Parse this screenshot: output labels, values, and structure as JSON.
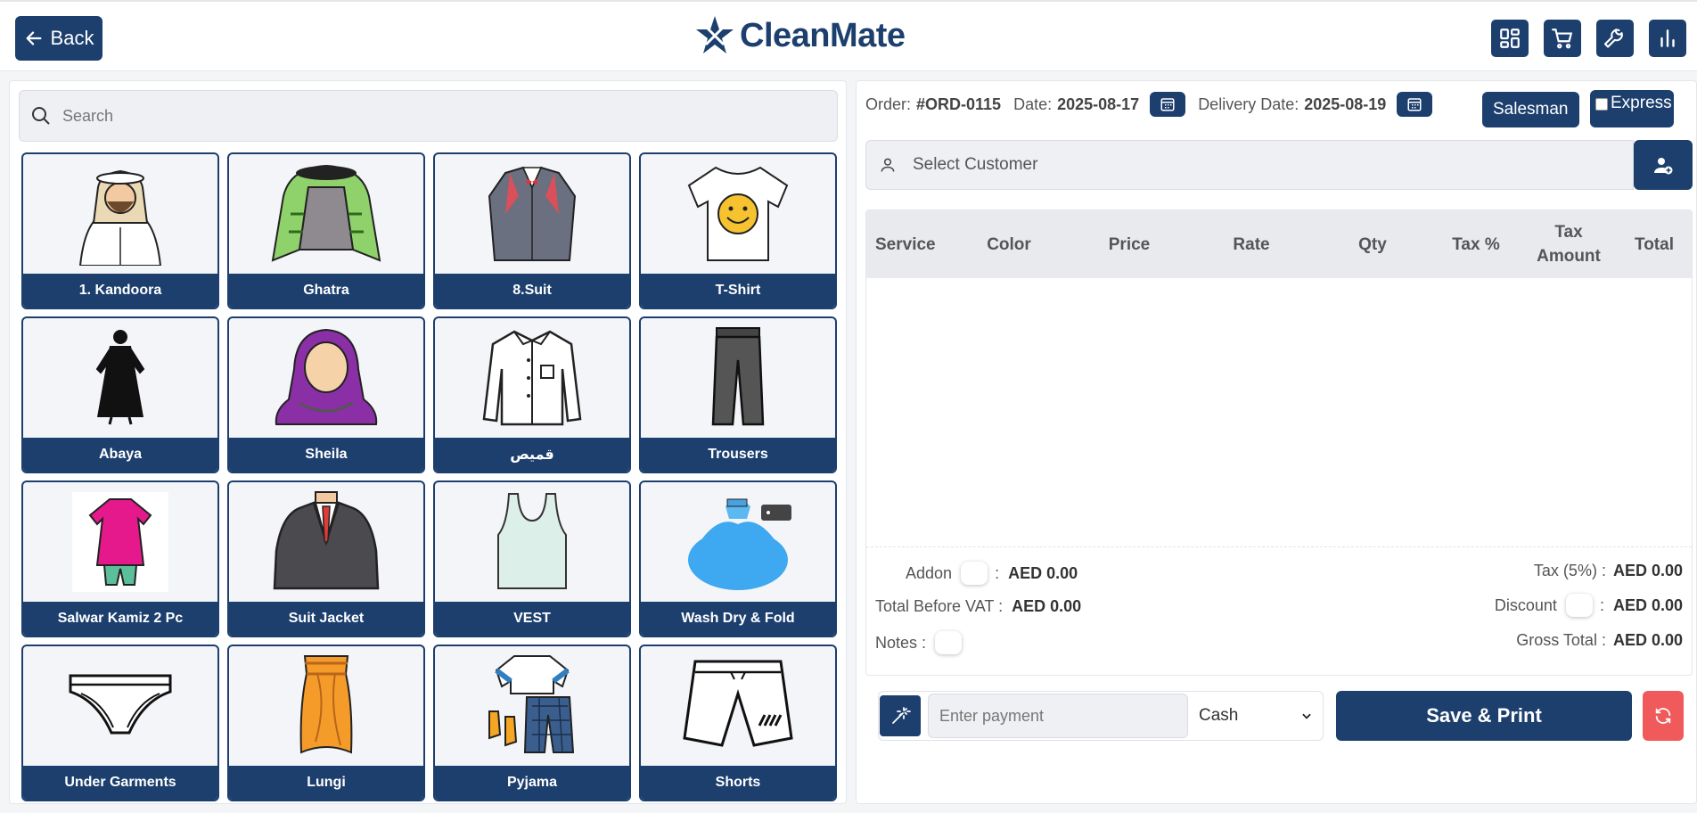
{
  "header": {
    "back_label": "Back",
    "brand": "CleanMate",
    "icons": [
      "grid-icon",
      "cart-icon",
      "wrench-icon",
      "bar-chart-icon"
    ],
    "accent_color": "#1c3f6e"
  },
  "search": {
    "placeholder": "Search"
  },
  "items": [
    {
      "label": "1. Kandoora",
      "icon": "kandoora-icon"
    },
    {
      "label": "Ghatra",
      "icon": "ghatra-icon"
    },
    {
      "label": "8.Suit",
      "icon": "suit-icon"
    },
    {
      "label": "T-Shirt",
      "icon": "tshirt-icon"
    },
    {
      "label": "Abaya",
      "icon": "abaya-icon"
    },
    {
      "label": "Sheila",
      "icon": "sheila-icon"
    },
    {
      "label": "قميص",
      "icon": "shirt-icon"
    },
    {
      "label": "Trousers",
      "icon": "trousers-icon"
    },
    {
      "label": "Salwar Kamiz 2 Pc",
      "icon": "salwar-kamiz-icon"
    },
    {
      "label": "Suit Jacket",
      "icon": "suit-jacket-icon"
    },
    {
      "label": "VEST",
      "icon": "vest-icon"
    },
    {
      "label": "Wash Dry & Fold",
      "icon": "laundry-bag-icon"
    },
    {
      "label": "Under Garments",
      "icon": "underwear-icon"
    },
    {
      "label": "Lungi",
      "icon": "lungi-icon"
    },
    {
      "label": "Pyjama",
      "icon": "pyjama-icon"
    },
    {
      "label": "Shorts",
      "icon": "shorts-icon"
    }
  ],
  "order": {
    "order_label": "Order:",
    "order_no": "#ORD-0115",
    "date_label": "Date:",
    "date": "2025-08-17",
    "delivery_label": "Delivery Date:",
    "delivery_date": "2025-08-19",
    "salesman_label": "Salesman",
    "express_label": "Express"
  },
  "customer": {
    "placeholder": "Select  Customer"
  },
  "table": {
    "columns": [
      "Service",
      "Color",
      "Price",
      "Rate",
      "Qty",
      "Tax %",
      "Tax Amount",
      "Total"
    ],
    "rows": []
  },
  "totals": {
    "addon_label": "Addon",
    "addon_value": "AED 0.00",
    "before_vat_label": "Total Before VAT :",
    "before_vat_value": "AED 0.00",
    "notes_label": "Notes :",
    "tax_label": "Tax (5%) :",
    "tax_value": "AED 0.00",
    "discount_label": "Discount",
    "discount_value": "AED 0.00",
    "gross_label": "Gross Total :",
    "gross_value": "AED 0.00",
    "colon": ":"
  },
  "payment": {
    "placeholder": "Enter payment",
    "method": "Cash",
    "save_label": "Save & Print"
  }
}
